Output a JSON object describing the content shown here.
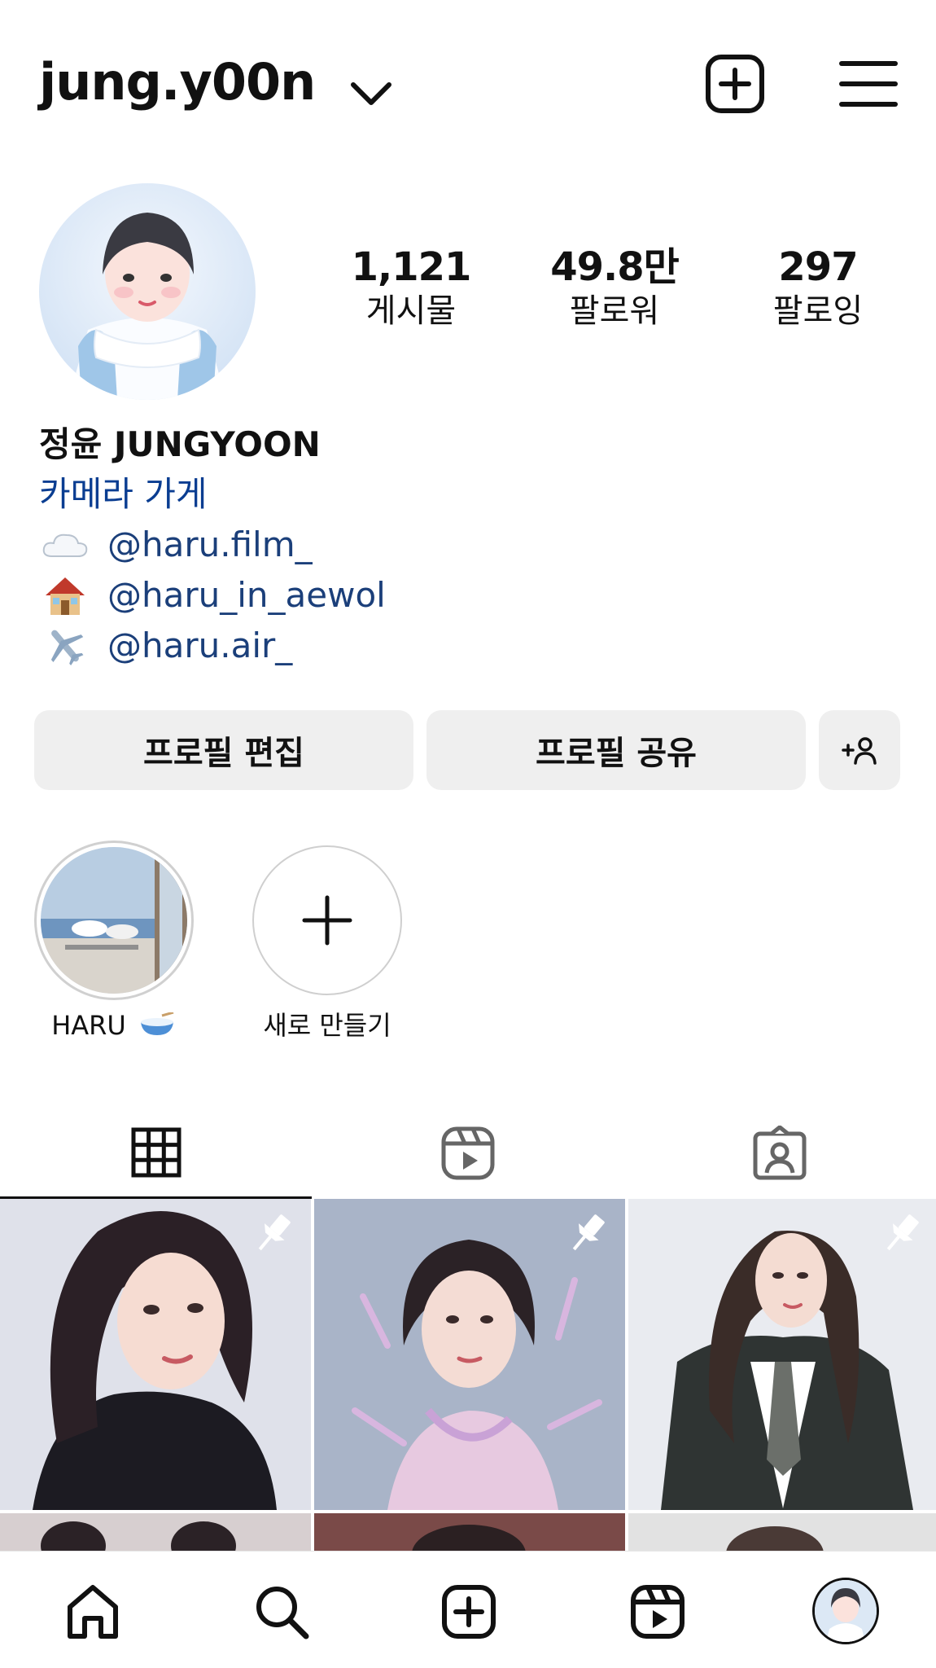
{
  "header": {
    "username": "jung.y00n",
    "icons": [
      "chevron-down-icon",
      "new-post-icon",
      "menu-icon"
    ]
  },
  "profile": {
    "stats": [
      {
        "value": "1,121",
        "label": "게시물"
      },
      {
        "value": "49.8만",
        "label": "팔로워"
      },
      {
        "value": "297",
        "label": "팔로잉"
      }
    ],
    "name": "정윤 JUNGYOON",
    "category": "카메라 가게",
    "links": [
      {
        "emoji": "cloud-icon",
        "text": "@haru.film_"
      },
      {
        "emoji": "house-icon",
        "text": "@haru_in_aewol"
      },
      {
        "emoji": "airplane-icon",
        "text": "@haru.air_"
      }
    ]
  },
  "buttons": {
    "edit_label": "프로필 편집",
    "share_label": "프로필 공유",
    "discover_icon": "add-person-icon"
  },
  "highlights": [
    {
      "label": "HARU",
      "emoji": "bowl-icon"
    },
    {
      "label": "새로 만들기"
    }
  ],
  "tabs": [
    "grid-icon",
    "reels-icon",
    "tagged-icon"
  ],
  "nav": [
    "home-icon",
    "search-icon",
    "create-icon",
    "reels-icon",
    "profile-avatar"
  ],
  "colors": {
    "link": "#1b3f7a",
    "button_bg": "#efefef",
    "text": "#111111"
  }
}
